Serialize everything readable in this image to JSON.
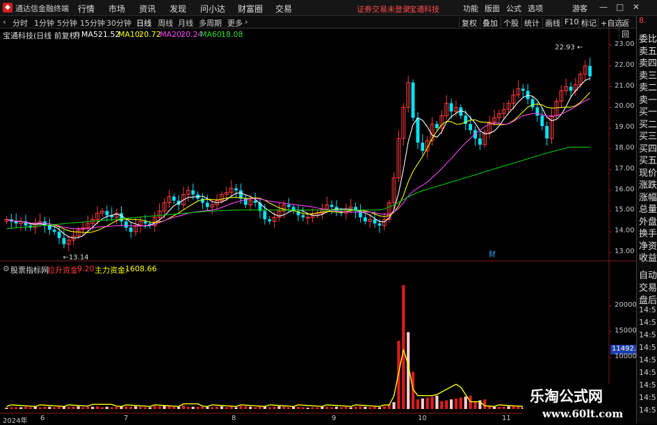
{
  "app": {
    "title": "通达信金融终端",
    "menu": [
      "行情",
      "市场",
      "资讯",
      "发现",
      "问小达",
      "财富圈",
      "交易"
    ],
    "warning": "证券交易未登录",
    "stock_name_top": "宝通科技",
    "right_menu": [
      "功能",
      "版面",
      "公式",
      "选项"
    ],
    "guest": "游客",
    "window_buttons": [
      "—",
      "□",
      "✕"
    ]
  },
  "toolbar": {
    "periods": [
      "分时",
      "1分钟",
      "5分钟",
      "15分钟",
      "30分钟",
      "日线",
      "周线",
      "月线",
      "多周期",
      "更多"
    ],
    "active": "日线",
    "right_buttons": [
      "复权",
      "叠加",
      "个股",
      "统计",
      "画线",
      "F10",
      "标记",
      "+自选",
      "返回"
    ]
  },
  "info": {
    "stock": "宝通科技(日线 前复权)",
    "ma5_label": "MA5:",
    "ma5": "21.52",
    "ma10_label": "MA10:",
    "ma10": "20.72",
    "ma20_label": "MA20:",
    "ma20": "20.24",
    "ma60_label": "MA60:",
    "ma60": "18.08"
  },
  "indicator": {
    "name": "股票指标网",
    "s1_label": "拉升资金:",
    "s1": "9.20",
    "s2_label": "主力资金:",
    "s2": "1608.66",
    "current_tag": "11492.66"
  },
  "right_panel": {
    "labels": [
      "委比",
      "卖五",
      "卖四",
      "卖三",
      "卖二",
      "卖一",
      "买一",
      "买二",
      "买三",
      "买四",
      "买五",
      "现价",
      "涨跌",
      "涨幅",
      "总量",
      "外盘",
      "换手",
      "净资",
      "收益"
    ],
    "bottom": [
      "自动",
      "交易",
      "盘后",
      "14:5",
      "14:5",
      "14:5",
      "14:5",
      "14:5",
      "14:5",
      "14:5",
      "14:5",
      "14:5"
    ],
    "top_tag": "8."
  },
  "chart_data": [
    {
      "type": "candlestick",
      "title": "宝通科技(日线 前复权)",
      "ylim": [
        12.7,
        23.3
      ],
      "yticks": [
        "23.00",
        "22.00",
        "21.00",
        "20.00",
        "19.00",
        "18.00",
        "17.00",
        "16.00",
        "15.00",
        "14.00",
        "13.00"
      ],
      "ytick_values": [
        23,
        22,
        21,
        20,
        19,
        18,
        17,
        16,
        15,
        14,
        13
      ],
      "annotations": {
        "high": "22.93",
        "low": "←13.14",
        "event_mark": "财"
      },
      "close": [
        14.6,
        14.5,
        14.4,
        14.5,
        14.3,
        14.2,
        14.4,
        14.5,
        14.3,
        14.1,
        14.0,
        13.7,
        13.4,
        13.6,
        13.8,
        14.1,
        14.2,
        14.4,
        14.6,
        14.9,
        15.0,
        14.8,
        14.7,
        14.9,
        14.5,
        14.2,
        14.0,
        14.3,
        14.5,
        14.4,
        14.3,
        14.7,
        15.0,
        15.4,
        15.7,
        15.5,
        15.3,
        15.8,
        16.0,
        15.8,
        15.6,
        15.4,
        15.2,
        15.3,
        15.5,
        15.8,
        15.9,
        16.1,
        16.0,
        15.6,
        15.3,
        15.5,
        15.4,
        15.0,
        14.6,
        14.5,
        14.7,
        15.0,
        15.3,
        15.2,
        15.0,
        14.8,
        14.7,
        14.7,
        14.8,
        14.9,
        15.1,
        15.3,
        15.2,
        15.0,
        14.9,
        15.1,
        15.2,
        15.0,
        14.7,
        14.5,
        14.6,
        14.4,
        14.3,
        14.6,
        15.4,
        16.6,
        18.5,
        20.0,
        21.2,
        19.5,
        18.3,
        17.9,
        18.4,
        19.2,
        19.0,
        19.6,
        20.2,
        19.8,
        20.0,
        19.6,
        19.2,
        18.9,
        18.5,
        18.2,
        18.8,
        19.3,
        19.5,
        19.7,
        19.9,
        20.2,
        20.6,
        20.9,
        20.8,
        20.4,
        20.0,
        19.6,
        19.1,
        18.5,
        19.6,
        20.3,
        20.8,
        21.0,
        20.8,
        21.1,
        21.6,
        22.0,
        21.5
      ],
      "ma60": [
        14.15,
        14.17,
        14.19,
        14.21,
        14.23,
        14.25,
        14.27,
        14.29,
        14.31,
        14.33,
        14.35,
        14.37,
        14.39,
        14.41,
        14.43,
        14.45,
        14.47,
        14.49,
        14.51,
        14.53,
        14.55,
        14.57,
        14.59,
        14.61,
        14.63,
        14.65,
        14.67,
        14.69,
        14.71,
        14.73,
        14.75,
        14.77,
        14.79,
        14.81,
        14.83,
        14.85,
        14.87,
        14.89,
        14.91,
        14.93,
        14.95,
        14.97,
        14.99,
        15.0,
        15.01,
        15.02,
        15.03,
        15.04,
        15.05,
        15.05,
        15.05,
        15.05,
        15.05,
        15.05,
        15.05,
        15.05,
        15.05,
        15.05,
        15.05,
        15.05,
        15.05,
        15.05,
        15.05,
        15.05,
        15.05,
        15.05,
        15.05,
        15.05,
        15.05,
        15.05,
        15.05,
        15.05,
        15.05,
        15.05,
        15.05,
        15.05,
        15.05,
        15.05,
        15.05,
        15.1,
        15.2,
        15.3,
        15.42,
        15.55,
        15.68,
        15.8,
        15.9,
        15.98,
        16.05,
        16.12,
        16.19,
        16.26,
        16.33,
        16.4,
        16.47,
        16.54,
        16.61,
        16.68,
        16.75,
        16.82,
        16.89,
        16.96,
        17.03,
        17.1,
        17.17,
        17.24,
        17.31,
        17.38,
        17.45,
        17.52,
        17.59,
        17.66,
        17.73,
        17.8,
        17.86,
        17.92,
        17.98,
        18.04,
        18.08,
        18.08,
        18.08,
        18.08,
        18.08
      ]
    },
    {
      "type": "bar+line",
      "title": "股票指标网",
      "ylim": [
        0,
        26000
      ],
      "yticks": [
        "20000",
        "15000",
        "10000"
      ],
      "ytick_values": [
        20000,
        15000,
        10000
      ],
      "bars": {
        "name": "拉升资金",
        "peak": 24000
      },
      "line": {
        "name": "主力资金",
        "peak": 11500,
        "secondary_peak": 4800
      }
    }
  ],
  "dates": [
    "2024年",
    "6",
    "7",
    "8",
    "9",
    "10",
    "11"
  ],
  "watermark": {
    "line1": "乐淘公式网",
    "line2": "www.60lt.com"
  },
  "colors": {
    "up": "#ff3b3b",
    "down": "#00e5ff",
    "ma5": "#ffffff",
    "ma10": "#ffff00",
    "ma20": "#ff44ff",
    "ma60": "#00cc00",
    "warn": "#ff4a4a"
  }
}
